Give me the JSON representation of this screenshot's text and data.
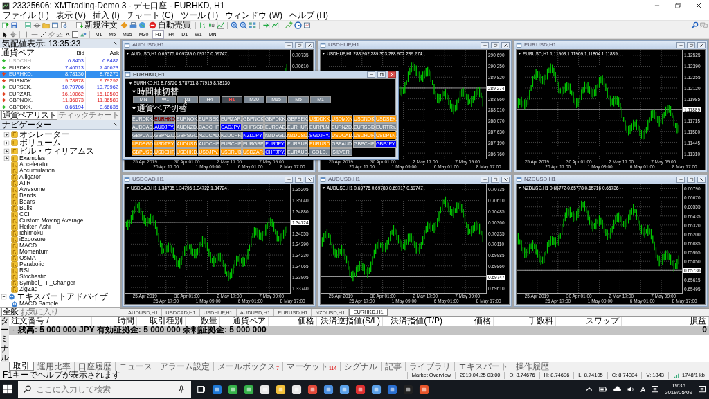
{
  "window": {
    "title": "23325606: XMTrading-Demo 3 - デモ口座 - EURHKD, H1"
  },
  "menu": [
    "ファイル (F)",
    "表示 (V)",
    "挿入 (I)",
    "チャート (C)",
    "ツール (T)",
    "ウィンドウ (W)",
    "ヘルプ (H)"
  ],
  "toolbar": {
    "buttons": [
      "新規注文",
      "自動売買"
    ],
    "text_tools": [
      "A",
      "T"
    ],
    "timeframes": [
      {
        "label": "M1",
        "selected": false
      },
      {
        "label": "M5",
        "selected": false
      },
      {
        "label": "M15",
        "selected": false
      },
      {
        "label": "M30",
        "selected": false
      },
      {
        "label": "H1",
        "selected": true
      },
      {
        "label": "H4",
        "selected": false
      },
      {
        "label": "D1",
        "selected": false
      },
      {
        "label": "W1",
        "selected": false
      },
      {
        "label": "MN",
        "selected": false
      }
    ]
  },
  "market_watch": {
    "title": "気配値表示: 13:35:33",
    "columns": [
      "通貨ペア",
      "Bid",
      "Ask"
    ],
    "rows": [
      {
        "symbol": "USDCNH",
        "bid": "6.8453",
        "ask": "6.8487",
        "rising": true,
        "disabled": true,
        "selected": false
      },
      {
        "symbol": "EURDKK.",
        "bid": "7.46513",
        "ask": "7.46623",
        "rising": true,
        "disabled": false,
        "selected": false
      },
      {
        "symbol": "EURHKD.",
        "bid": "8.78136",
        "ask": "8.78275",
        "rising": false,
        "disabled": false,
        "selected": true
      },
      {
        "symbol": "EURNOK.",
        "bid": "9.78878",
        "ask": "9.79292",
        "rising": false,
        "disabled": false,
        "selected": false
      },
      {
        "symbol": "EURSEK.",
        "bid": "10.79706",
        "ask": "10.79962",
        "rising": true,
        "disabled": false,
        "selected": false
      },
      {
        "symbol": "EURZAR.",
        "bid": "16.10062",
        "ask": "16.10503",
        "rising": false,
        "disabled": false,
        "selected": false
      },
      {
        "symbol": "GBPNOK.",
        "bid": "11.36073",
        "ask": "11.36589",
        "rising": false,
        "disabled": false,
        "selected": false
      },
      {
        "symbol": "GBPDKK.",
        "bid": "8.66194",
        "ask": "8.66635",
        "rising": true,
        "disabled": false,
        "selected": false
      }
    ],
    "tabs": [
      {
        "label": "通貨ペアリスト",
        "selected": true
      },
      {
        "label": "ティックチャート",
        "selected": false
      }
    ]
  },
  "navigator": {
    "title": "ナビゲーター",
    "indicators": [
      {
        "label": "オシレーター",
        "kind": "folder",
        "expanded": false
      },
      {
        "label": "ボリューム",
        "kind": "folder",
        "expanded": false
      },
      {
        "label": "ビル・ウィリアムス",
        "kind": "folder",
        "expanded": false
      },
      {
        "label": "Examples",
        "kind": "folder",
        "expanded": false
      },
      {
        "label": "Accelerator",
        "kind": "indicator"
      },
      {
        "label": "Accumulation",
        "kind": "indicator"
      },
      {
        "label": "Alligator",
        "kind": "indicator"
      },
      {
        "label": "ATR",
        "kind": "indicator"
      },
      {
        "label": "Awesome",
        "kind": "indicator"
      },
      {
        "label": "Bands",
        "kind": "indicator"
      },
      {
        "label": "Bears",
        "kind": "indicator"
      },
      {
        "label": "Bulls",
        "kind": "indicator"
      },
      {
        "label": "CCI",
        "kind": "indicator"
      },
      {
        "label": "Custom Moving Average",
        "kind": "indicator"
      },
      {
        "label": "Heiken Ashi",
        "kind": "indicator"
      },
      {
        "label": "Ichimoku",
        "kind": "indicator"
      },
      {
        "label": "iExposure",
        "kind": "indicator"
      },
      {
        "label": "MACD",
        "kind": "indicator"
      },
      {
        "label": "Momentum",
        "kind": "indicator"
      },
      {
        "label": "OsMA",
        "kind": "indicator"
      },
      {
        "label": "Parabolic",
        "kind": "indicator"
      },
      {
        "label": "RSI",
        "kind": "indicator"
      },
      {
        "label": "Stochastic",
        "kind": "indicator"
      },
      {
        "label": "Symbol_TF_Changer",
        "kind": "indicator"
      },
      {
        "label": "ZigZag",
        "kind": "indicator"
      }
    ],
    "experts": {
      "label": "エキスパートアドバイザ",
      "expanded": true,
      "children": [
        {
          "label": "MACD Sample"
        }
      ]
    },
    "tabs": [
      {
        "label": "全般",
        "selected": true
      },
      {
        "label": "お気に入り",
        "selected": false
      }
    ]
  },
  "charts": [
    {
      "title": "AUDUSD,H1",
      "info": "AUDUSD,H1  0.69775 0.69789 0.69717 0.69747",
      "prices": [
        {
          "label": "0.70735",
          "current": false
        },
        {
          "label": "0.70610",
          "current": false
        }
      ],
      "dates": [
        "25 Apr 2019",
        "26 Apr 17:00",
        "30 Apr 01:00",
        "1 May 09:00",
        "2 May 17:00",
        "6 May 01:00",
        "7 May 09:00",
        "8 May 17:00"
      ]
    },
    {
      "title": "USDHUF,H1",
      "info": "USDHUF,H1  288.902 289.353 288.902 289.274",
      "prices": [
        {
          "label": "290.690",
          "current": false
        },
        {
          "label": "290.250",
          "current": false
        },
        {
          "label": "289.820",
          "current": false
        },
        {
          "label": "289.274",
          "current": true
        },
        {
          "label": "288.960",
          "current": false
        },
        {
          "label": "288.510",
          "current": false
        },
        {
          "label": "288.070",
          "current": false
        },
        {
          "label": "287.630",
          "current": false
        },
        {
          "label": "287.190",
          "current": false
        },
        {
          "label": "286.760",
          "current": false
        }
      ],
      "dates": [
        "25 Apr 2019",
        "26 Apr 17:00",
        "30 Apr 01:00",
        "1 May 09:00",
        "2 May 17:00",
        "6 May 01:00",
        "7 May 09:00",
        "8 May 17:00"
      ]
    },
    {
      "title": "EURUSD,H1",
      "info": "EURUSD,H1  1.11963 1.11969 1.11864 1.11889",
      "prices": [
        {
          "label": "1.12525",
          "current": false
        },
        {
          "label": "1.12390",
          "current": false
        },
        {
          "label": "1.12255",
          "current": false
        },
        {
          "label": "1.12120",
          "current": false
        },
        {
          "label": "1.11985",
          "current": false
        },
        {
          "label": "1.11889",
          "current": true
        },
        {
          "label": "1.11715",
          "current": false
        },
        {
          "label": "1.11580",
          "current": false
        },
        {
          "label": "1.11445",
          "current": false
        },
        {
          "label": "1.11310",
          "current": false
        }
      ],
      "dates": [
        "25 Apr 2019",
        "26 Apr 17:00",
        "30 Apr 01:00",
        "1 May 09:00",
        "2 May 17:00",
        "6 May 01:00",
        "7 May 09:00",
        "8 May 17:00"
      ]
    },
    {
      "title": "USDCAD,H1",
      "info": "USDCAD,H1  1.34785 1.34796 1.34722 1.34724",
      "prices": [
        {
          "label": "1.35205",
          "current": false
        },
        {
          "label": "1.35040",
          "current": false
        },
        {
          "label": "1.34880",
          "current": false
        },
        {
          "label": "1.34724",
          "current": true
        },
        {
          "label": "1.34555",
          "current": false
        },
        {
          "label": "1.34390",
          "current": false
        },
        {
          "label": "1.34230",
          "current": false
        },
        {
          "label": "1.34065",
          "current": false
        },
        {
          "label": "1.33905",
          "current": false
        },
        {
          "label": "1.33740",
          "current": false
        }
      ],
      "dates": [
        "25 Apr 2019",
        "26 Apr 17:00",
        "30 Apr 01:00",
        "1 May 09:00",
        "2 May 17:00",
        "6 May 01:00",
        "7 May 09:00",
        "8 May 17:00"
      ]
    },
    {
      "title": "AUDUSD,H1",
      "info": "AUDUSD,H1  0.69775 0.69789 0.69717 0.69747",
      "prices": [
        {
          "label": "0.70735",
          "current": false
        },
        {
          "label": "0.70610",
          "current": false
        },
        {
          "label": "0.70485",
          "current": false
        },
        {
          "label": "0.70360",
          "current": false
        },
        {
          "label": "0.70235",
          "current": false
        },
        {
          "label": "0.70110",
          "current": false
        },
        {
          "label": "0.69985",
          "current": false
        },
        {
          "label": "0.69860",
          "current": false
        },
        {
          "label": "0.69747",
          "current": true
        },
        {
          "label": "0.69610",
          "current": false
        }
      ],
      "dates": [
        "25 Apr 2019",
        "26 Apr 17:00",
        "30 Apr 01:00",
        "1 May 09:00",
        "2 May 17:00",
        "6 May 01:00",
        "7 May 09:00",
        "8 May 17:00"
      ]
    },
    {
      "title": "NZDUSD,H1",
      "info": "NZDUSD,H1  0.65772 0.65778 0.65716 0.65736",
      "prices": [
        {
          "label": "0.66790",
          "current": false
        },
        {
          "label": "0.66670",
          "current": false
        },
        {
          "label": "0.66555",
          "current": false
        },
        {
          "label": "0.66435",
          "current": false
        },
        {
          "label": "0.66320",
          "current": false
        },
        {
          "label": "0.66200",
          "current": false
        },
        {
          "label": "0.66085",
          "current": false
        },
        {
          "label": "0.65965",
          "current": false
        },
        {
          "label": "0.65850",
          "current": false
        },
        {
          "label": "0.65736",
          "current": true
        },
        {
          "label": "0.65615",
          "current": false
        },
        {
          "label": "0.65495",
          "current": false
        }
      ],
      "dates": [
        "25 Apr 2019",
        "26 Apr 17:00",
        "30 Apr 01:00",
        "1 May 09:00",
        "2 May 17:00",
        "6 May 01:00",
        "7 May 09:00",
        "8 May 17:00"
      ]
    }
  ],
  "dialog": {
    "title": "EURHKD,H1",
    "info": "EURHKD,H1  8.78726 8.78751 8.77919 8.78136",
    "timeframe_heading": "時間軸切替",
    "timeframes": [
      {
        "label": "MN",
        "selected": false
      },
      {
        "label": "W1",
        "selected": false
      },
      {
        "label": "D1",
        "selected": false
      },
      {
        "label": "H4",
        "selected": false
      },
      {
        "label": "H1",
        "selected": true
      },
      {
        "label": "M30",
        "selected": false
      },
      {
        "label": "M15",
        "selected": false
      },
      {
        "label": "M5",
        "selected": false
      },
      {
        "label": "M1",
        "selected": false
      }
    ],
    "pairs_heading": "通貨ペア切替",
    "pairs": [
      {
        "label": "EURDKK.",
        "color": "#7b8793",
        "selected": false
      },
      {
        "label": "EURHKD.",
        "color": "#7b8793",
        "selected": true
      },
      {
        "label": "EURNOK.",
        "color": "#7b8793",
        "selected": false
      },
      {
        "label": "EURSEK.",
        "color": "#7b8793",
        "selected": false
      },
      {
        "label": "EURZAR.",
        "color": "#7b8793",
        "selected": false
      },
      {
        "label": "GBPNOK.",
        "color": "#7b8793",
        "selected": false
      },
      {
        "label": "GBPDKK.",
        "color": "#7b8793",
        "selected": false
      },
      {
        "label": "GBPSEK.",
        "color": "#7b8793",
        "selected": false
      },
      {
        "label": "USDDKK.",
        "color": "#ff9900",
        "selected": false
      },
      {
        "label": "USDMXN.",
        "color": "#ff9900",
        "selected": false
      },
      {
        "label": "USDNOK.",
        "color": "#ff9900",
        "selected": false
      },
      {
        "label": "USDSEK.",
        "color": "#ff9900",
        "selected": false
      },
      {
        "label": "AUDCAD.",
        "color": "#7b8793",
        "selected": false
      },
      {
        "label": "AUDJPY.",
        "color": "#0000ff",
        "selected": false
      },
      {
        "label": "AUDNZD.",
        "color": "#7b8793",
        "selected": false
      },
      {
        "label": "CADCHF.",
        "color": "#7b8793",
        "selected": false
      },
      {
        "label": "CADJPY.",
        "color": "#0000ff",
        "selected": false
      },
      {
        "label": "CHFSGD.",
        "color": "#7b8793",
        "selected": false
      },
      {
        "label": "EURCAD.",
        "color": "#7b8793",
        "selected": false
      },
      {
        "label": "EURHUF.",
        "color": "#7b8793",
        "selected": false
      },
      {
        "label": "EURPLN.",
        "color": "#7b8793",
        "selected": false
      },
      {
        "label": "EURNZD.",
        "color": "#7b8793",
        "selected": false
      },
      {
        "label": "EURSGD.",
        "color": "#7b8793",
        "selected": false
      },
      {
        "label": "EURTRY.",
        "color": "#7b8793",
        "selected": false
      },
      {
        "label": "GBPCAD.",
        "color": "#7b8793",
        "selected": false
      },
      {
        "label": "GBPNZD.",
        "color": "#7b8793",
        "selected": false
      },
      {
        "label": "GBPSGD.",
        "color": "#7b8793",
        "selected": false
      },
      {
        "label": "NZDCAD.",
        "color": "#7b8793",
        "selected": false
      },
      {
        "label": "NZDCHF.",
        "color": "#7b8793",
        "selected": false
      },
      {
        "label": "NZDJPY.",
        "color": "#0000ff",
        "selected": false
      },
      {
        "label": "NZDSGD.",
        "color": "#7b8793",
        "selected": false
      },
      {
        "label": "NZDUSD.",
        "color": "#ff9900",
        "selected": false
      },
      {
        "label": "SGDJPY.",
        "color": "#0000ff",
        "selected": false
      },
      {
        "label": "USDCAD.",
        "color": "#ff9900",
        "selected": false
      },
      {
        "label": "USDHUF.",
        "color": "#ff9900",
        "selected": false
      },
      {
        "label": "USDPLN.",
        "color": "#ff9900",
        "selected": false
      },
      {
        "label": "USDSGD.",
        "color": "#ff9900",
        "selected": false
      },
      {
        "label": "USDTRY.",
        "color": "#ff9900",
        "selected": false
      },
      {
        "label": "AUDUSD.",
        "color": "#ff9900",
        "selected": false
      },
      {
        "label": "AUDCHF.",
        "color": "#7b8793",
        "selected": false
      },
      {
        "label": "EURCHF.",
        "color": "#7b8793",
        "selected": false
      },
      {
        "label": "EURGBP.",
        "color": "#7b8793",
        "selected": false
      },
      {
        "label": "EURJPY.",
        "color": "#0000ff",
        "selected": false
      },
      {
        "label": "EURRUB.",
        "color": "#7b8793",
        "selected": false
      },
      {
        "label": "EURUSD.",
        "color": "#ff9900",
        "selected": false
      },
      {
        "label": "GBPAUD.",
        "color": "#7b8793",
        "selected": false
      },
      {
        "label": "GBPCHF.",
        "color": "#7b8793",
        "selected": false
      },
      {
        "label": "GBPJPY.",
        "color": "#0000ff",
        "selected": false
      },
      {
        "label": "GBPUSD.",
        "color": "#ff9900",
        "selected": false
      },
      {
        "label": "USDCHF.",
        "color": "#ff9900",
        "selected": false
      },
      {
        "label": "USDHKD.",
        "color": "#ff9900",
        "selected": false
      },
      {
        "label": "USDJPY.",
        "color": "#ff9900",
        "selected": false
      },
      {
        "label": "USDRUB.",
        "color": "#ff9900",
        "selected": false
      },
      {
        "label": "USDZAR.",
        "color": "#ff9900",
        "selected": false
      },
      {
        "label": "CHFJPY.",
        "color": "#0000ff",
        "selected": false
      },
      {
        "label": "EURAUD.",
        "color": "#7b8793",
        "selected": false
      },
      {
        "label": "GOLD.",
        "color": "#7b8793",
        "selected": false
      },
      {
        "label": "SILVER.",
        "color": "#7b8793",
        "selected": false
      }
    ]
  },
  "chart_tabs": [
    {
      "label": "AUDUSD,H1",
      "selected": false
    },
    {
      "label": "USDCAD,H1",
      "selected": false
    },
    {
      "label": "USDHUF,H1",
      "selected": false
    },
    {
      "label": "AUDUSD,H1",
      "selected": false
    },
    {
      "label": "EURUSD,H1",
      "selected": false
    },
    {
      "label": "NZDUSD,H1",
      "selected": false
    },
    {
      "label": "EURHKD,H1",
      "selected": true
    }
  ],
  "terminal": {
    "side_label": "ターミナル",
    "columns": [
      "注文番号 /",
      "時間",
      "取引種別",
      "数量",
      "通貨ペア",
      "価格",
      "決済逆指値(S/L)",
      "決済指値(T/P)",
      "価格",
      "手数料",
      "スワップ",
      "損益"
    ],
    "balance": "残高: 5 000 000 JPY  有効証拠金: 5 000 000  余剰証拠金: 5 000 000",
    "profit": "0",
    "tabs": [
      {
        "label": "取引",
        "selected": true
      },
      {
        "label": "運用比率",
        "selected": false
      },
      {
        "label": "口座履歴",
        "selected": false
      },
      {
        "label": "ニュース",
        "selected": false
      },
      {
        "label": "アラーム設定",
        "selected": false
      },
      {
        "label": "メールボックス",
        "count": "7",
        "selected": false
      },
      {
        "label": "マーケット",
        "count": "114",
        "selected": false
      },
      {
        "label": "シグナル",
        "selected": false
      },
      {
        "label": "記事",
        "selected": false
      },
      {
        "label": "ライブラリ",
        "selected": false
      },
      {
        "label": "エキスパート",
        "selected": false
      },
      {
        "label": "操作履歴",
        "selected": false
      }
    ]
  },
  "status_bar": {
    "help": "F1キーでヘルプが表示されます",
    "items": [
      "Market Overview",
      "2019.04.25 03:00",
      "O: 8.74676",
      "H: 8.74696",
      "L: 8.74105",
      "C: 8.74384",
      "V: 1843",
      "1748/1 kb"
    ]
  },
  "taskbar": {
    "search": {
      "placeholder": "ここに入力して検索"
    },
    "ime": "A",
    "time": "19:35",
    "date": "2019/05/09"
  }
}
